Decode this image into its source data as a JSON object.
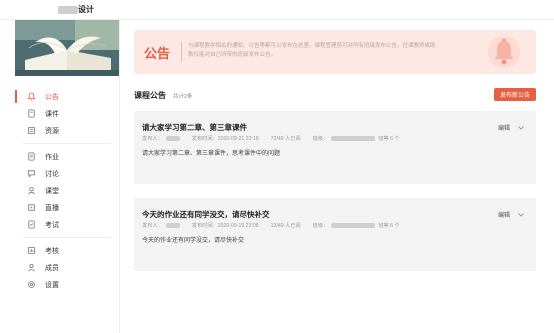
{
  "header": {
    "course_title_suffix": "设计"
  },
  "sidebar": {
    "items": [
      {
        "label": "公告",
        "icon": "bell-icon",
        "active": true
      },
      {
        "label": "课件",
        "icon": "document-icon"
      },
      {
        "label": "资源",
        "icon": "folder-icon"
      },
      {
        "label": "作业",
        "icon": "assignment-icon"
      },
      {
        "label": "讨论",
        "icon": "chat-icon"
      },
      {
        "label": "课堂",
        "icon": "classroom-icon"
      },
      {
        "label": "直播",
        "icon": "live-icon"
      },
      {
        "label": "考试",
        "icon": "exam-icon"
      },
      {
        "label": "考核",
        "icon": "assessment-icon"
      },
      {
        "label": "成员",
        "icon": "members-icon"
      },
      {
        "label": "设置",
        "icon": "settings-icon"
      }
    ]
  },
  "banner": {
    "title": "公告",
    "text": "与课程教学相关的通知、公告等都可以发布在这里。课程管理员可对所有班级发布公告，任课教师或助教仅能对自己所带的班级发布公告。"
  },
  "announcements": {
    "title": "课程公告",
    "subtitle": "共计2条",
    "publish_label": "发布新公告",
    "items": [
      {
        "title": "请大家学习第二章、第三章课件",
        "publisher_label": "发布人：",
        "publish_time": "发布时间：2020-09-21 22:18",
        "views": "73/49 人已阅",
        "class_label": "班级：",
        "class_suffix": "班等 6 个",
        "body": "请大家学习第二章、第三章课件，思考课件中的问题",
        "edit_label": "编辑"
      },
      {
        "title": "今天的作业还有同学没交，请尽快补交",
        "publisher_label": "发布人：",
        "publish_time": "发布时间：2020-09-19 23:08",
        "views": "13/49 人已阅",
        "class_label": "班级：",
        "class_suffix": "班等 6 个",
        "body": "今天的作业还有同学没交，请尽快补交",
        "edit_label": "编辑"
      }
    ]
  },
  "colors": {
    "accent": "#e55f40",
    "banner_bg": "#fde8e4",
    "card_bg": "#f3f3f4"
  }
}
